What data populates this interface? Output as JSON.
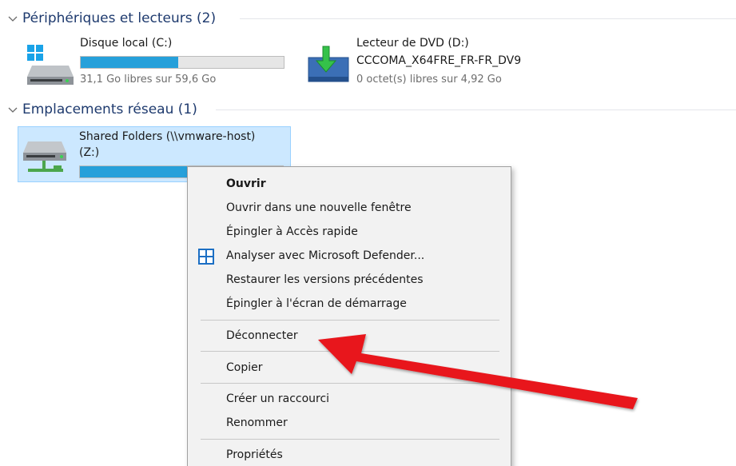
{
  "groups": {
    "devices": {
      "title": "Périphériques et lecteurs (2)"
    },
    "network": {
      "title": "Emplacements réseau (1)"
    }
  },
  "drives": {
    "c": {
      "name": "Disque local (C:)",
      "info": "31,1 Go libres sur 59,6 Go",
      "used_fraction": 0.48,
      "icon": "windows-drive-icon"
    },
    "d": {
      "name": "Lecteur de DVD (D:)",
      "volume": "CCCOMA_X64FRE_FR-FR_DV9",
      "info": "0 octet(s) libres sur 4,92 Go",
      "icon": "dvd-drive-icon"
    },
    "z": {
      "name": "Shared Folders (\\\\vmware-host)",
      "letter": "(Z:)",
      "used_fraction": 0.6,
      "icon": "network-drive-icon"
    }
  },
  "context_menu": {
    "items": {
      "open": "Ouvrir",
      "open_new_window": "Ouvrir dans une nouvelle fenêtre",
      "pin_quick_access": "Épingler à Accès rapide",
      "scan_defender": "Analyser avec Microsoft Defender...",
      "restore_versions": "Restaurer les versions précédentes",
      "pin_start": "Épingler à l'écran de démarrage",
      "disconnect": "Déconnecter",
      "copy": "Copier",
      "create_shortcut": "Créer un raccourci",
      "rename": "Renommer",
      "properties": "Propriétés"
    }
  },
  "colors": {
    "accent_bar": "#26a0da",
    "selection": "#cce8ff",
    "annotation_arrow": "#e8151b"
  }
}
